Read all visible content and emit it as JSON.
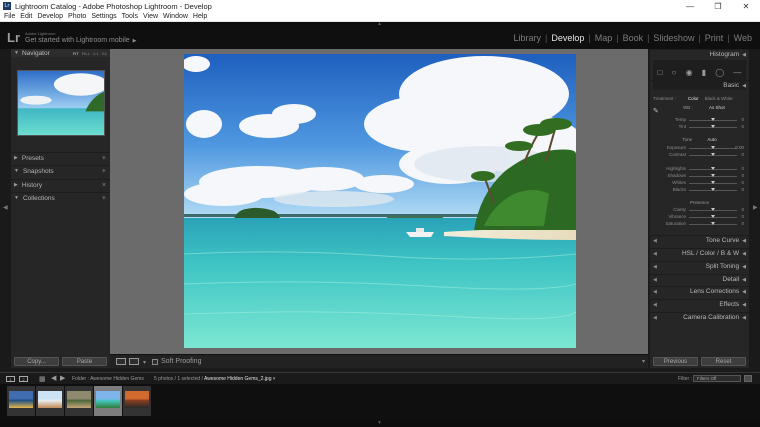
{
  "window": {
    "icon": "Lr",
    "title": "Lightroom Catalog - Adobe Photoshop Lightroom - Develop",
    "controls": [
      "minimize-icon",
      "maximize-icon",
      "close-icon"
    ]
  },
  "menu": {
    "items": [
      "File",
      "Edit",
      "Develop",
      "Photo",
      "Settings",
      "Tools",
      "View",
      "Window",
      "Help"
    ]
  },
  "identity": {
    "logo": "Lr",
    "adobe_small": "Adobe Lightroom",
    "get_started": "Get started with Lightroom mobile"
  },
  "modules": {
    "items": [
      "Library",
      "Develop",
      "Map",
      "Book",
      "Slideshow",
      "Print",
      "Web"
    ],
    "active": "Develop"
  },
  "left_panel": {
    "navigator": {
      "label": "Navigator",
      "zooms": [
        "FIT",
        "FILL",
        "1:1",
        "3:1"
      ],
      "active_zoom": "FIT"
    },
    "sections": [
      {
        "label": "Presets"
      },
      {
        "label": "Snapshots"
      },
      {
        "label": "History"
      },
      {
        "label": "Collections"
      }
    ],
    "copy_label": "Copy...",
    "paste_label": "Paste"
  },
  "toolbar": {
    "soft_proofing_label": "Soft Proofing"
  },
  "right_panel": {
    "histogram_label": "Histogram",
    "basic_label": "Basic",
    "treatment": {
      "label": "Treatment :",
      "color": "Color",
      "bw": "Black & White"
    },
    "wb": {
      "label": "WB :",
      "value": "As Shot"
    },
    "sliders_wb": [
      {
        "label": "Temp",
        "value": "0",
        "pos": 0.5
      },
      {
        "label": "Tint",
        "value": "0",
        "pos": 0.5
      }
    ],
    "tone": {
      "label": "Tone",
      "auto": "Auto"
    },
    "sliders_tone": [
      {
        "label": "Exposure",
        "value": "0.00",
        "pos": 0.5
      },
      {
        "label": "Contrast",
        "value": "0",
        "pos": 0.5
      }
    ],
    "sliders_tone2": [
      {
        "label": "Highlights",
        "value": "0",
        "pos": 0.5
      },
      {
        "label": "Shadows",
        "value": "0",
        "pos": 0.5
      },
      {
        "label": "Whites",
        "value": "0",
        "pos": 0.5
      },
      {
        "label": "Blacks",
        "value": "0",
        "pos": 0.5
      }
    ],
    "presence_label": "Presence",
    "sliders_presence": [
      {
        "label": "Clarity",
        "value": "0",
        "pos": 0.5
      },
      {
        "label": "Vibrance",
        "value": "0",
        "pos": 0.5
      },
      {
        "label": "Saturation",
        "value": "0",
        "pos": 0.5
      }
    ],
    "panels": [
      {
        "label": "Tone Curve"
      },
      {
        "label": "HSL / Color / B & W"
      },
      {
        "label": "Split Toning"
      },
      {
        "label": "Detail"
      },
      {
        "label": "Lens Corrections"
      },
      {
        "label": "Effects"
      },
      {
        "label": "Camera Calibration"
      }
    ],
    "previous_label": "Previous",
    "reset_label": "Reset"
  },
  "filmstrip_bar": {
    "mon1": "1",
    "mon2": "2",
    "folder_label": "Folder : Awesome Hidden Gems",
    "count": "5 photos / 1 selected /",
    "filename": "Awesome Hidden Gems_2.jpg",
    "filter_label": "Filter :",
    "filter_value": "Filters Off"
  },
  "filmstrip": {
    "thumbs": [
      {
        "name": "thumb-1",
        "selected": false,
        "colors": [
          "#3f6db0",
          "#1f4f82",
          "#e6b64d"
        ]
      },
      {
        "name": "thumb-2",
        "selected": false,
        "colors": [
          "#cbe3f5",
          "#e9edf1",
          "#c38a55"
        ]
      },
      {
        "name": "thumb-3",
        "selected": false,
        "colors": [
          "#8f8a6e",
          "#4a6a3a",
          "#c9a57a"
        ]
      },
      {
        "name": "thumb-4",
        "selected": true,
        "colors": [
          "#7fb4ea",
          "#48c9c5",
          "#2e7d3a"
        ]
      },
      {
        "name": "thumb-5",
        "selected": false,
        "colors": [
          "#d26a2f",
          "#8a3d20",
          "#2a2a2a"
        ]
      }
    ]
  }
}
